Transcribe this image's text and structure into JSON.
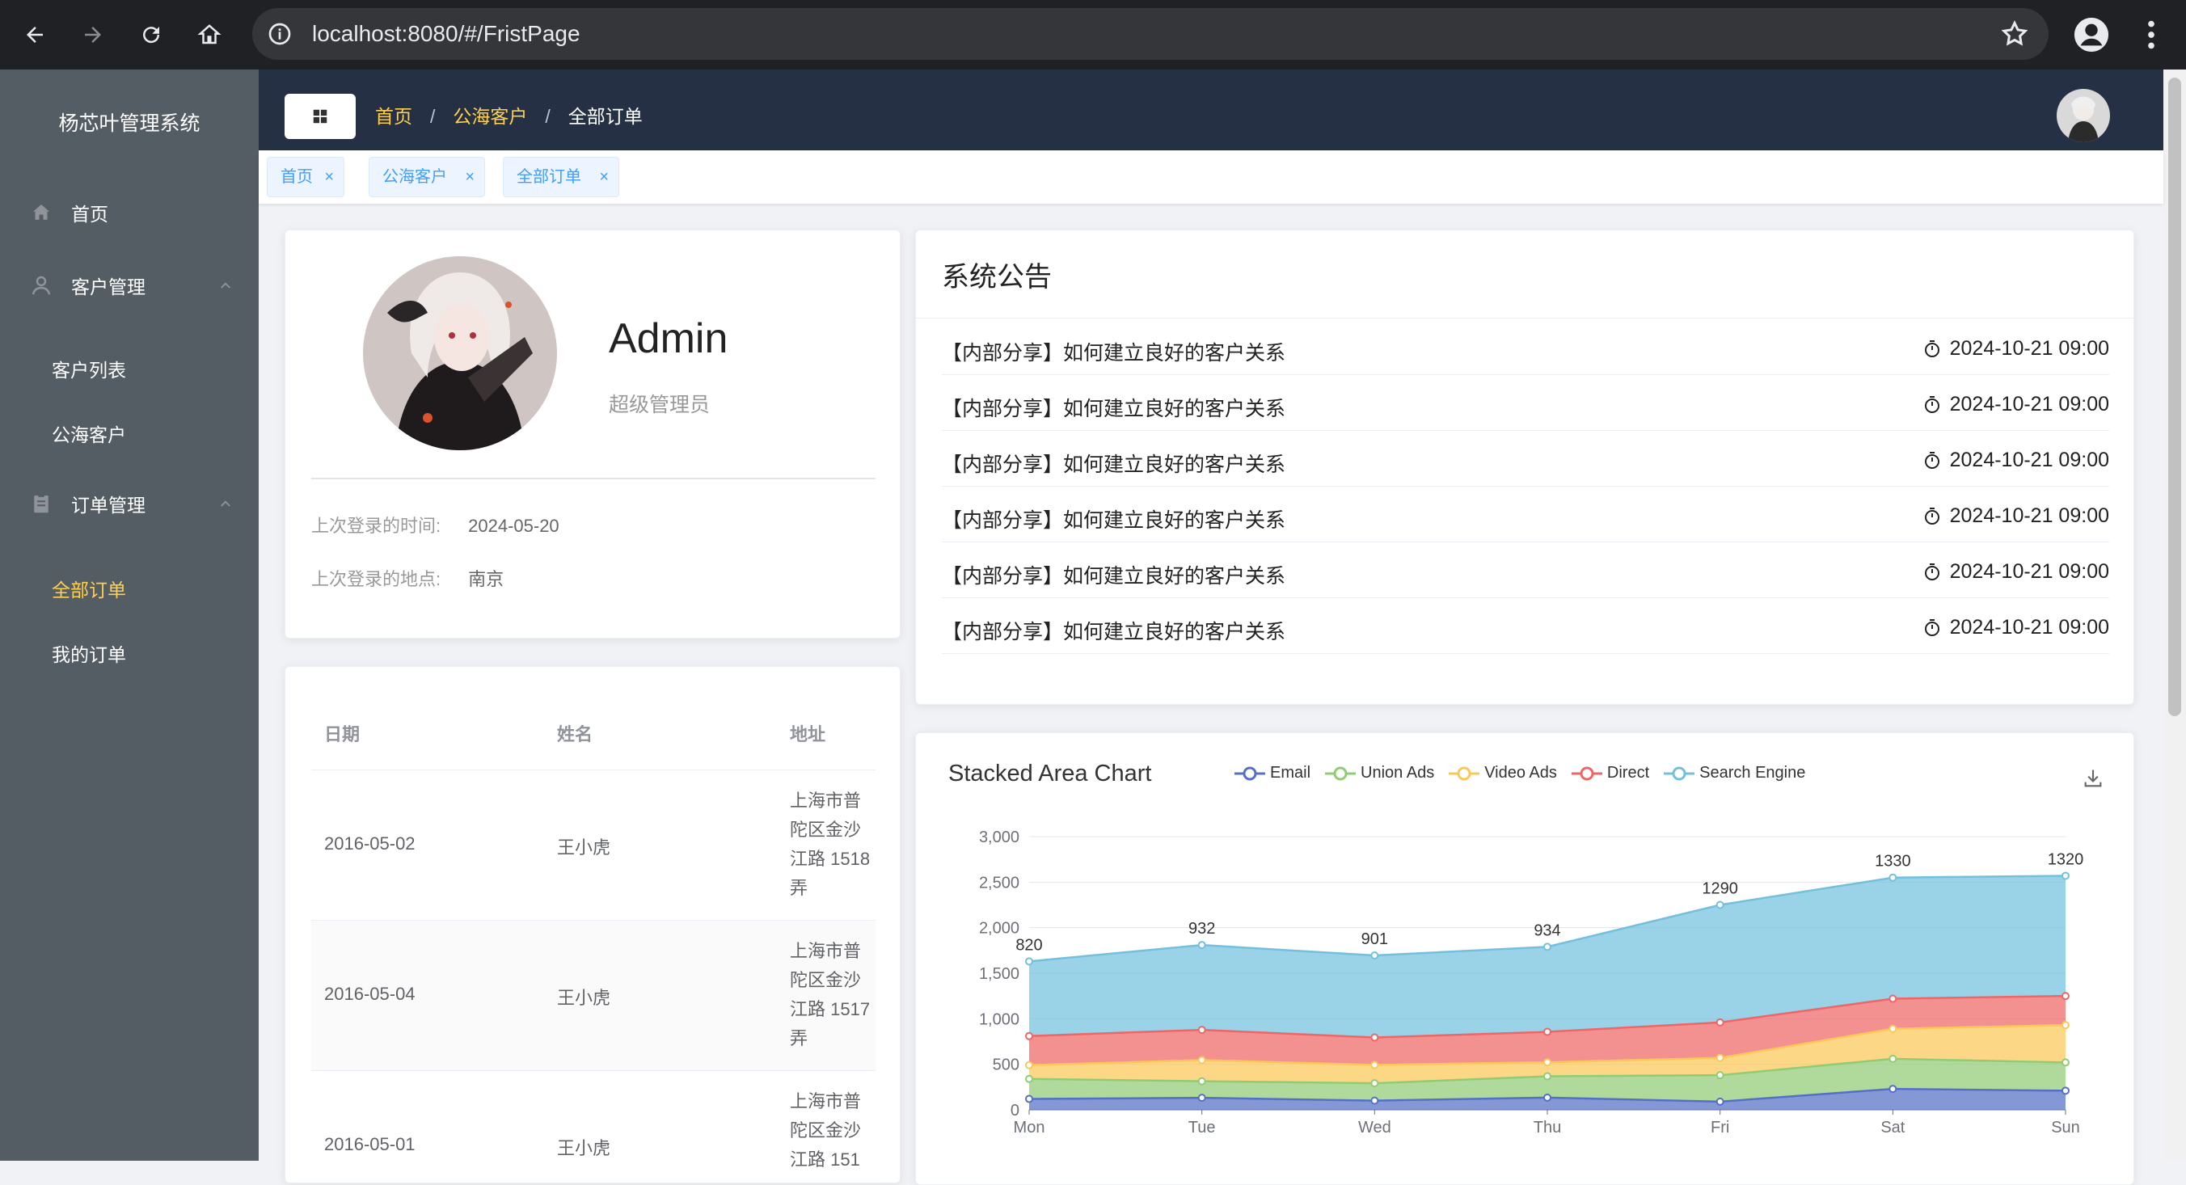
{
  "browser": {
    "url": "localhost:8080/#/FristPage",
    "icons": [
      "back-icon",
      "forward-icon",
      "reload-icon",
      "home-icon",
      "info-icon",
      "star-icon",
      "profile-icon",
      "menu-icon"
    ]
  },
  "sidebar": {
    "app_title": "杨芯叶管理系统",
    "home": "首页",
    "customer_group": "客户管理",
    "customer_items": [
      "客户列表",
      "公海客户"
    ],
    "order_group": "订单管理",
    "order_items": [
      "全部订单",
      "我的订单"
    ],
    "active_item": "全部订单",
    "active_color": "#ffd04b",
    "background": "#545c64"
  },
  "header": {
    "breadcrumb": [
      "首页",
      "公海客户",
      "全部订单"
    ],
    "separator": "/",
    "background": "#253045"
  },
  "tags": [
    {
      "label": "首页",
      "close": "×"
    },
    {
      "label": "公海客户",
      "close": "×"
    },
    {
      "label": "全部订单",
      "close": "×"
    }
  ],
  "user": {
    "name": "Admin",
    "role": "超级管理员",
    "last_login_time_label": "上次登录的时间:",
    "last_login_time": "2024-05-20",
    "last_login_place_label": "上次登录的地点:",
    "last_login_place": "南京"
  },
  "table": {
    "headers": [
      "日期",
      "姓名",
      "地址"
    ],
    "rows": [
      {
        "date": "2016-05-02",
        "name": "王小虎",
        "address": "上海市普陀区金沙江路 1518 弄"
      },
      {
        "date": "2016-05-04",
        "name": "王小虎",
        "address": "上海市普陀区金沙江路 1517 弄"
      },
      {
        "date": "2016-05-01",
        "name": "王小虎",
        "address": "上海市普陀区金沙江路 151"
      }
    ]
  },
  "notices": {
    "title": "系统公告",
    "items": [
      {
        "text": "【内部分享】如何建立良好的客户关系",
        "time": "2024-10-21 09:00"
      },
      {
        "text": "【内部分享】如何建立良好的客户关系",
        "time": "2024-10-21 09:00"
      },
      {
        "text": "【内部分享】如何建立良好的客户关系",
        "time": "2024-10-21 09:00"
      },
      {
        "text": "【内部分享】如何建立良好的客户关系",
        "time": "2024-10-21 09:00"
      },
      {
        "text": "【内部分享】如何建立良好的客户关系",
        "time": "2024-10-21 09:00"
      },
      {
        "text": "【内部分享】如何建立良好的客户关系",
        "time": "2024-10-21 09:00"
      }
    ]
  },
  "chart_data": {
    "type": "area",
    "stacked": true,
    "title": "Stacked Area Chart",
    "categories": [
      "Mon",
      "Tue",
      "Wed",
      "Thu",
      "Fri",
      "Sat",
      "Sun"
    ],
    "y_ticks": [
      "0",
      "500",
      "1,000",
      "1,500",
      "2,000",
      "2,500",
      "3,000"
    ],
    "ylim": [
      0,
      3000
    ],
    "grid": true,
    "legend_position": "top",
    "series": [
      {
        "name": "Email",
        "color": "#5470c6",
        "values": [
          120,
          132,
          101,
          134,
          90,
          230,
          210
        ]
      },
      {
        "name": "Union Ads",
        "color": "#91cc75",
        "values": [
          220,
          182,
          191,
          234,
          290,
          330,
          310
        ]
      },
      {
        "name": "Video Ads",
        "color": "#fac858",
        "values": [
          150,
          232,
          201,
          154,
          190,
          330,
          410
        ]
      },
      {
        "name": "Direct",
        "color": "#ee6666",
        "values": [
          320,
          332,
          301,
          334,
          390,
          330,
          320
        ]
      },
      {
        "name": "Search Engine",
        "color": "#73c0de",
        "values": [
          820,
          932,
          901,
          934,
          1290,
          1330,
          1320
        ]
      }
    ],
    "top_labels": [
      "820",
      "932",
      "901",
      "934",
      "1290",
      "1330",
      "1320"
    ],
    "download_icon": "download-icon"
  }
}
